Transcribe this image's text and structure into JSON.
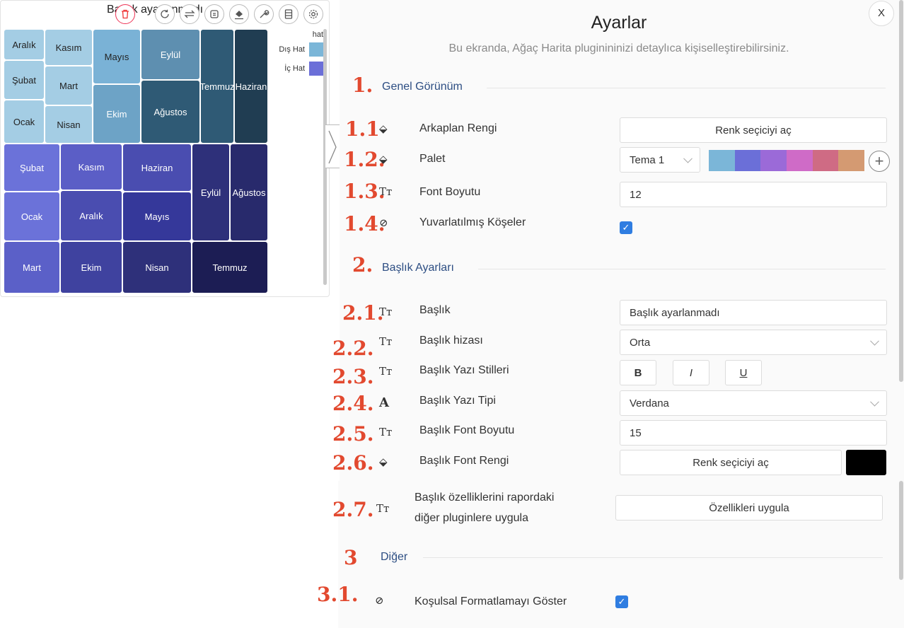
{
  "chart": {
    "title": "Başlık ayarlanmadı",
    "toolbar_icons": [
      "trash-icon",
      "refresh-icon",
      "swap-icon",
      "copy-icon",
      "paint-bucket-icon",
      "wrench-icon",
      "table-icon",
      "gear-icon"
    ],
    "legend": {
      "title": "hat",
      "items": [
        {
          "label": "Dış Hat",
          "color": "#7bb6d8"
        },
        {
          "label": "İç Hat",
          "color": "#6b6fd8"
        }
      ]
    }
  },
  "chart_data": {
    "type": "treemap",
    "groups": [
      {
        "name": "Dış Hat",
        "cells": [
          "Aralık",
          "Kasım",
          "Mayıs",
          "Eylül",
          "Temmuz",
          "Haziran",
          "Şubat",
          "Mart",
          "Ekim",
          "Ağustos",
          "Ocak",
          "Nisan"
        ]
      },
      {
        "name": "İç Hat",
        "cells": [
          "Şubat",
          "Kasım",
          "Haziran",
          "Eylül",
          "Ağustos",
          "Ocak",
          "Aralık",
          "Mayıs",
          "Mart",
          "Ekim",
          "Nisan",
          "Temmuz"
        ]
      }
    ]
  },
  "settings": {
    "title": "Ayarlar",
    "subtitle": "Bu ekranda, Ağaç Harita pluginininizi detaylıca kişiselleştirebilirsiniz.",
    "close": "X",
    "sections": [
      {
        "num": "1.",
        "title": "Genel Görünüm"
      },
      {
        "num": "2.",
        "title": "Başlık Ayarları"
      },
      {
        "num": "3",
        "title": "Diğer"
      }
    ],
    "rows": {
      "bg": {
        "num": "1.1",
        "icon": "paint-bucket-icon",
        "label": "Arkaplan Rengi",
        "button": "Renk seçiciyi aç"
      },
      "pal": {
        "num": "1.2.",
        "icon": "paint-bucket-icon",
        "label": "Palet",
        "select": "Tema 1",
        "colors": [
          "#7bb6d8",
          "#6b6fd8",
          "#9b6ad8",
          "#cf6bc7",
          "#cf6b84",
          "#d49a72"
        ]
      },
      "font": {
        "num": "1.3.",
        "icon": "font-size-icon",
        "label": "Font Boyutu",
        "value": "12"
      },
      "round": {
        "num": "1.4.",
        "icon": "eye-off-icon",
        "label": "Yuvarlatılmış Köşeler",
        "checked": true
      },
      "title": {
        "num": "2.1.",
        "icon": "font-size-icon",
        "label": "Başlık",
        "value": "Başlık ayarlanmadı"
      },
      "align": {
        "num": "2.2.",
        "icon": "font-size-icon",
        "label": "Başlık hizası",
        "value": "Orta"
      },
      "style": {
        "num": "2.3.",
        "icon": "font-size-icon",
        "label": "Başlık Yazı Stilleri",
        "bold": "B",
        "italic": "I",
        "underline": "U"
      },
      "face": {
        "num": "2.4.",
        "icon": "font-icon",
        "label": "Başlık Yazı Tipi",
        "value": "Verdana"
      },
      "tsize": {
        "num": "2.5.",
        "icon": "font-size-icon",
        "label": "Başlık Font Boyutu",
        "value": "15"
      },
      "tcolor": {
        "num": "2.6.",
        "icon": "paint-bucket-icon",
        "label": "Başlık Font Rengi",
        "button": "Renk seçiciyi aç",
        "color": "#000000"
      },
      "apply": {
        "num": "2.7.",
        "icon": "font-size-icon",
        "label_line1": "Başlık özelliklerini rapordaki",
        "label_line2": "diğer pluginlere uygula",
        "button": "Özellikleri uygula"
      },
      "cond": {
        "num": "3.1.",
        "icon": "eye-off-icon",
        "label": "Koşulsal Formatlamayı Göster",
        "checked": true
      }
    }
  }
}
